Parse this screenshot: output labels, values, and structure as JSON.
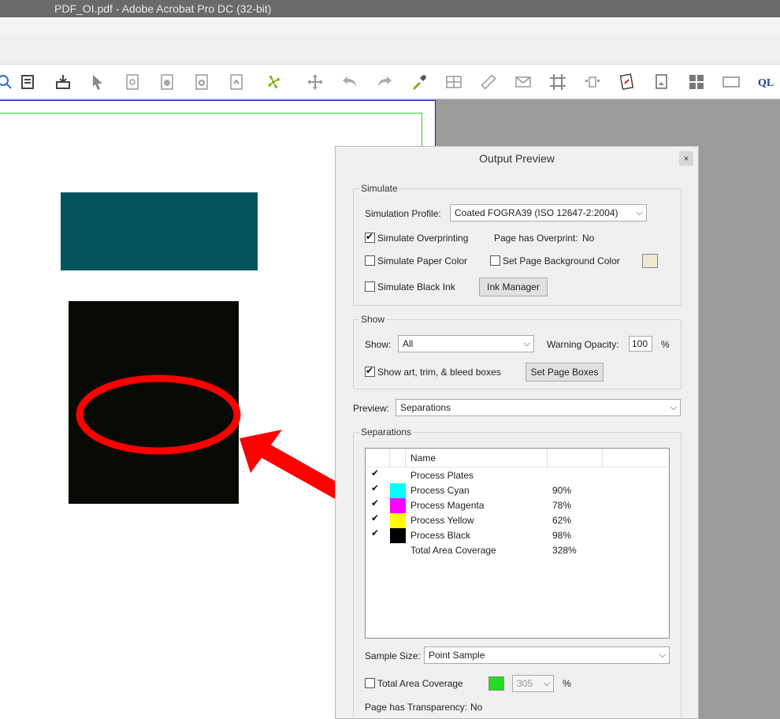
{
  "window": {
    "title": "PDF_OI.pdf - Adobe Acrobat Pro DC (32-bit)"
  },
  "toolbar": {
    "icons": [
      "search-icon",
      "edit-form-icon",
      "save-download-icon",
      "select-arrow-icon",
      "find-page-icon",
      "color-icon",
      "preflight-icon",
      "fix-icon",
      "fan-tool-icon",
      "move-icon",
      "undo-icon",
      "redo-icon",
      "eyedropper-icon",
      "table-icon",
      "ruler-icon",
      "envelope-icon",
      "crop-marks-icon",
      "align-icon",
      "pdf-edit-icon",
      "pdf-image-icon",
      "grid-icon",
      "rectangle-icon",
      "ql-icon"
    ]
  },
  "output_preview": {
    "title": "Output Preview",
    "close": "×",
    "simulate": {
      "group_label": "Simulate",
      "profile_label": "Simulation Profile:",
      "profile_value": "Coated FOGRA39 (ISO 12647-2:2004)",
      "overprinting_label": "Simulate Overprinting",
      "overprint_status_label": "Page has Overprint:",
      "overprint_status_value": "No",
      "paper_color_label": "Simulate Paper Color",
      "page_bg_label": "Set Page Background Color",
      "black_ink_label": "Simulate Black Ink",
      "ink_manager": "Ink Manager"
    },
    "show": {
      "group_label": "Show",
      "show_label": "Show:",
      "show_value": "All",
      "warning_label": "Warning Opacity:",
      "warning_value": "100",
      "warning_unit": "%",
      "boxes_label": "Show art, trim, & bleed boxes",
      "set_page_boxes": "Set Page Boxes"
    },
    "preview": {
      "label": "Preview:",
      "value": "Separations"
    },
    "separations": {
      "group_label": "Separations",
      "header_name": "Name",
      "rows": [
        {
          "name": "Process Plates",
          "value": "",
          "color": "",
          "checked": true
        },
        {
          "name": "Process Cyan",
          "value": "90%",
          "color": "#00ffff",
          "checked": true
        },
        {
          "name": "Process Magenta",
          "value": "78%",
          "color": "#ff00ff",
          "checked": true
        },
        {
          "name": "Process Yellow",
          "value": "62%",
          "color": "#ffff00",
          "checked": true
        },
        {
          "name": "Process Black",
          "value": "98%",
          "color": "#000000",
          "checked": true
        },
        {
          "name": "Total Area Coverage",
          "value": "328%",
          "color": "",
          "checked": false
        }
      ],
      "sample_size_label": "Sample Size:",
      "sample_size_value": "Point Sample",
      "total_coverage_label": "Total Area Coverage",
      "total_coverage_value": "305",
      "total_coverage_unit": "%",
      "transparency_label": "Page has Transparency:",
      "transparency_value": "No"
    }
  },
  "colors": {
    "teal": "#04535f",
    "black_object": "#070a04",
    "annotation_red": "#ff0000",
    "coverage_swatch": "#22dd22"
  }
}
